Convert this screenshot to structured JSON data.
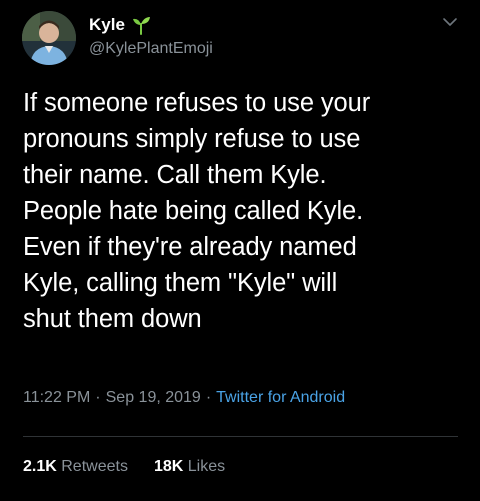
{
  "author": {
    "display_name": "Kyle",
    "handle": "@KylePlantEmoji",
    "name_emoji": "seedling-icon",
    "avatar": "profile-photo"
  },
  "tweet": {
    "text": "If someone refuses to use your\npronouns simply refuse to use\ntheir name. Call them Kyle.\nPeople hate being called Kyle.\nEven if they're already named\nKyle, calling them \"Kyle\" will\nshut them down"
  },
  "meta": {
    "time": "11:22 PM",
    "separator": "·",
    "date": "Sep 19, 2019",
    "source": "Twitter for Android"
  },
  "stats": {
    "retweets_count": "2.1K",
    "retweets_label": "Retweets",
    "likes_count": "18K",
    "likes_label": "Likes"
  },
  "colors": {
    "background": "#000000",
    "text_primary": "#ffffff",
    "text_secondary": "#8a9299",
    "link": "#4aa3e6",
    "divider": "#2f3336",
    "sprout": "#7ac943"
  }
}
